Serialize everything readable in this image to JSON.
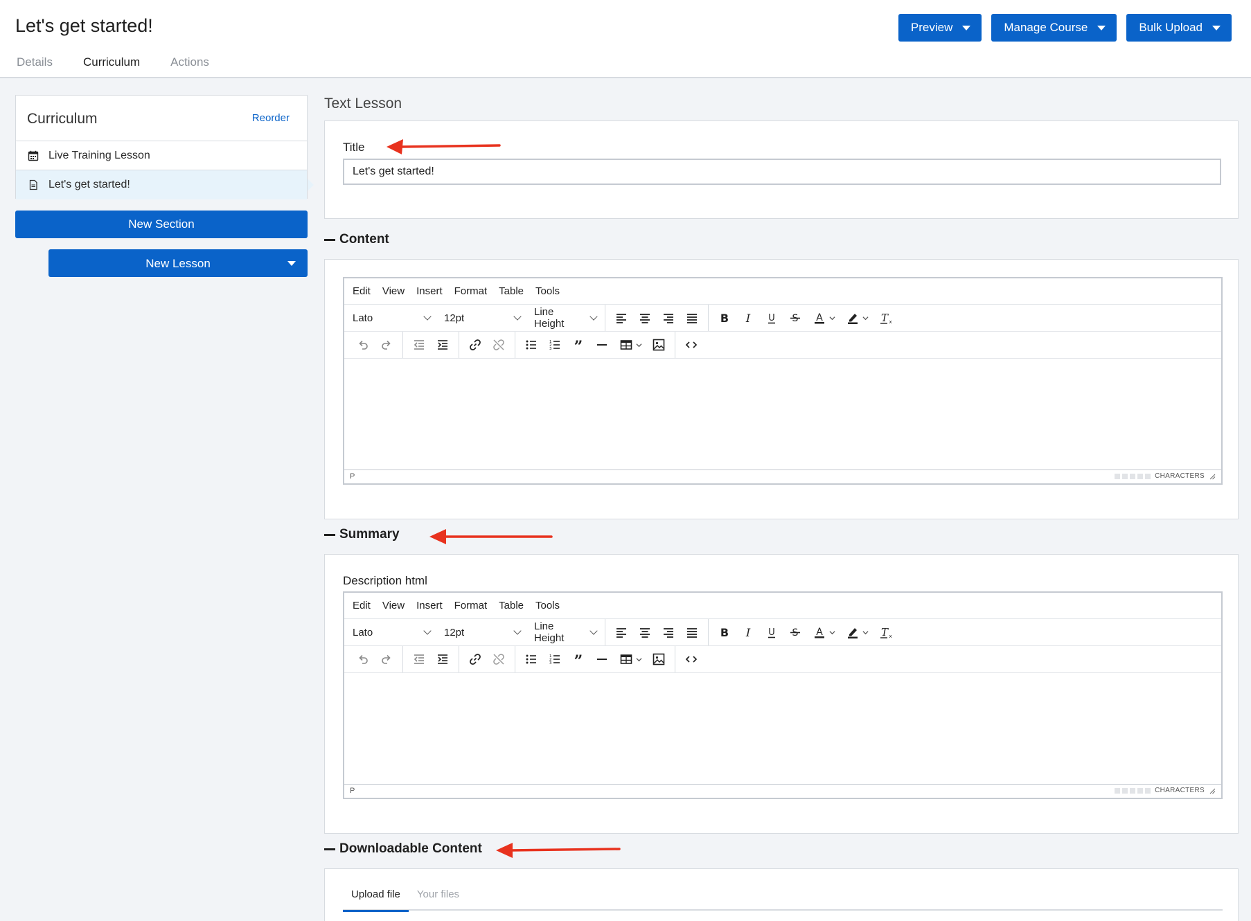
{
  "header": {
    "title": "Let's get started!",
    "tabs": [
      {
        "label": "Details"
      },
      {
        "label": "Curriculum"
      },
      {
        "label": "Actions"
      }
    ],
    "active_tab": "Curriculum",
    "buttons": {
      "preview": "Preview",
      "manage_course": "Manage Course",
      "bulk_upload": "Bulk Upload"
    }
  },
  "sidebar": {
    "title": "Curriculum",
    "reorder": "Reorder",
    "items": [
      {
        "label": "Live Training Lesson",
        "icon": "calendar-icon"
      },
      {
        "label": "Let's get started!",
        "icon": "document-icon",
        "selected": true
      }
    ],
    "new_section": "New Section",
    "new_lesson": "New Lesson"
  },
  "main": {
    "lesson_type": "Text Lesson",
    "title_field": {
      "label": "Title",
      "value": "Let's get started!"
    },
    "content_section": "Content",
    "summary_section": "Summary",
    "description_label": "Description html",
    "downloadable_section": "Downloadable Content",
    "download_tabs": {
      "upload": "Upload file",
      "files": "Your files"
    }
  },
  "editor": {
    "menu": [
      "Edit",
      "View",
      "Insert",
      "Format",
      "Table",
      "Tools"
    ],
    "font_family": "Lato",
    "font_size": "12pt",
    "line_height": "Line Height",
    "status_path": "P",
    "characters": "CHARACTERS"
  },
  "colors": {
    "primary": "#0a63c9",
    "annotation_arrow": "#e8321e",
    "page_background": "#f2f4f7"
  }
}
